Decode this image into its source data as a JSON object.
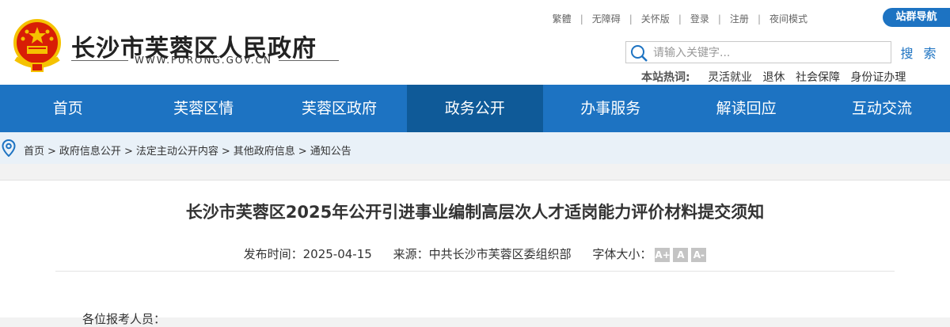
{
  "header": {
    "site_title": "长沙市芙蓉区人民政府",
    "site_domain": "WWW.FURONG.GOV.CN",
    "top_links": [
      "繁體",
      "无障碍",
      "关怀版",
      "登录",
      "注册",
      "夜间模式"
    ],
    "nav_pill": "站群导航",
    "search": {
      "placeholder": "请输入关键字...",
      "button_label": "搜 索"
    },
    "hot_words": {
      "label": "本站热词:",
      "items": [
        "灵活就业",
        "退休",
        "社会保障",
        "身份证办理"
      ]
    }
  },
  "nav": {
    "items": [
      "首页",
      "芙蓉区情",
      "芙蓉区政府",
      "政务公开",
      "办事服务",
      "解读回应",
      "互动交流"
    ],
    "active_index": 3
  },
  "breadcrumb": {
    "items": [
      "首页",
      "政府信息公开",
      "法定主动公开内容",
      "其他政府信息",
      "通知公告"
    ],
    "separator": ">"
  },
  "article": {
    "title": "长沙市芙蓉区2025年公开引进事业编制高层次人才适岗能力评价材料提交须知",
    "publish_label": "发布时间：",
    "publish_date": "2025-04-15",
    "source_label": "来源：",
    "source": "中共长沙市芙蓉区委组织部",
    "font_size_label": "字体大小：",
    "font_buttons": [
      "A+",
      "A",
      "A-"
    ],
    "body_first_line": "各位报考人员："
  },
  "colors": {
    "primary_blue": "#1d73c2",
    "active_nav": "#0f5a98",
    "breadcrumb_bg": "#e9f1f8",
    "emblem_red": "#d81e06",
    "emblem_gold": "#f5c200"
  }
}
